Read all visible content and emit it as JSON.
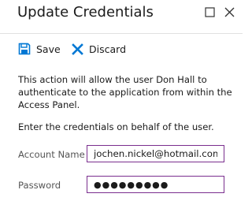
{
  "dialog": {
    "title": "Update Credentials"
  },
  "toolbar": {
    "save_label": "Save",
    "discard_label": "Discard"
  },
  "body": {
    "description": "This action will allow the user Don Hall to authenticate to the application from within the Access Panel.",
    "instruction": "Enter the credentials on behalf of the user."
  },
  "form": {
    "account_name_label": "Account Name",
    "account_name_value": "jochen.nickel@hotmail.com",
    "password_label": "Password",
    "password_value": "●●●●●●●●●"
  },
  "icons": {
    "maximize": "maximize-icon",
    "close": "close-icon",
    "save": "save-icon",
    "discard": "discard-icon"
  },
  "colors": {
    "accent": "#0078d4",
    "input_border": "#7a2e8e",
    "divider": "#e1e1e1"
  }
}
